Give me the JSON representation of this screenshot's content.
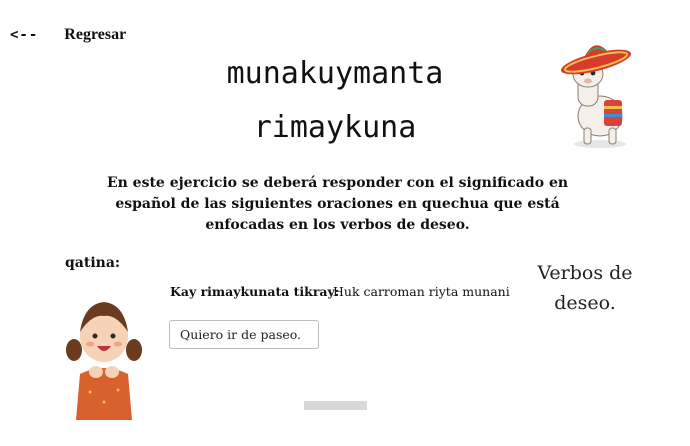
{
  "nav": {
    "back_arrow": "<--",
    "back_label": "Regresar"
  },
  "title": {
    "line1": "munakuymanta",
    "line2": "rimaykuna"
  },
  "instructions": "En este ejercicio se deberá responder con el significado en español de las siguientes oraciones en quechua que está enfocadas en los verbos de deseo.",
  "section": {
    "label": "qatina:"
  },
  "exercise": {
    "prompt_label": "Kay rimaykunata tikray:",
    "prompt_sentence": "Huk carroman riyta munani",
    "answer_value": "Quiero ir de paseo."
  },
  "topic": "Verbos de deseo.",
  "illustrations": {
    "top_right": "llama-with-sombrero-icon",
    "bottom_left": "girl-with-pigtails-icon"
  },
  "colors": {
    "submit_bar": "#d9d9d9",
    "input_border": "#bdbdbd"
  }
}
